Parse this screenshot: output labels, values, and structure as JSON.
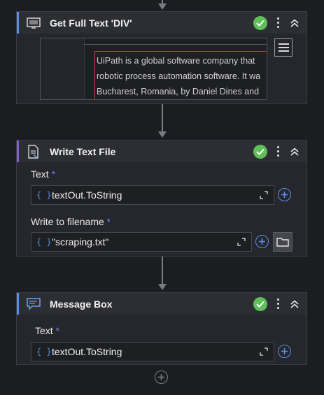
{
  "activities": [
    {
      "title": "Get Full Text 'DIV'",
      "icon": "screen-scrape-icon",
      "preview_lines": [
        "UiPath is a global software company that",
        "robotic process automation software. It wa",
        "Bucharest, Romania, by Daniel Dines and"
      ]
    },
    {
      "title": "Write Text File",
      "icon": "write-file-icon",
      "fields": [
        {
          "label": "Text",
          "required_mark": "*",
          "value": "textOut.ToString"
        },
        {
          "label": "Write to filename",
          "required_mark": "*",
          "value": "\"scraping.txt\""
        }
      ]
    },
    {
      "title": "Message Box",
      "icon": "message-box-icon",
      "fields": [
        {
          "label": "Text",
          "required_mark": "*",
          "value": "textOut.ToString"
        }
      ]
    }
  ],
  "expression_brace": "{ }",
  "colors": {
    "background": "#1c1d21",
    "card": "#26272c",
    "accent_blue": "#5b8def",
    "success_green": "#5fbf5a",
    "highlight_red": "#d93a3a"
  }
}
